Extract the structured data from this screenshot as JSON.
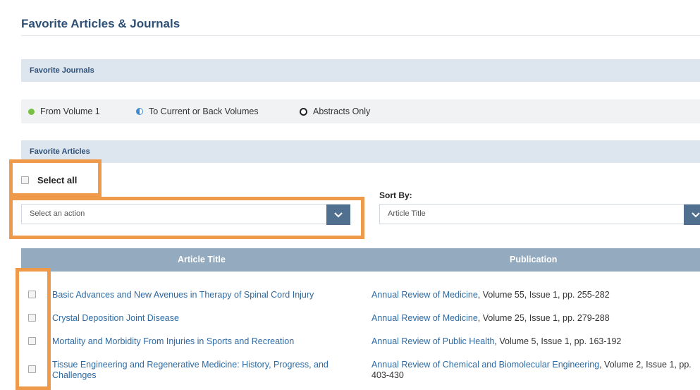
{
  "page": {
    "title": "Favorite Articles & Journals"
  },
  "favorite_journals": {
    "heading": "Favorite Journals"
  },
  "legend": {
    "items": [
      {
        "label": "From Volume 1",
        "icon": "green-dot-icon",
        "color": "#77c043"
      },
      {
        "label": "To Current or Back Volumes",
        "icon": "half-filled-dot-icon",
        "color": "#3a8ad3"
      },
      {
        "label": "Abstracts Only",
        "icon": "open-circle-icon",
        "color": "#222222"
      }
    ]
  },
  "favorite_articles": {
    "heading": "Favorite Articles",
    "select_all_label": "Select all",
    "action_placeholder": "Select an action",
    "sort_by_label": "Sort By:",
    "sort_value": "Article Title"
  },
  "table": {
    "headers": {
      "title": "Article Title",
      "publication": "Publication"
    },
    "rows": [
      {
        "title": "Basic Advances and New Avenues in Therapy of Spinal Cord Injury",
        "journal": "Annual Review of Medicine",
        "details": ", Volume 55, Issue 1, pp. 255-282"
      },
      {
        "title": "Crystal Deposition Joint Disease",
        "journal": "Annual Review of Medicine",
        "details": ", Volume 25, Issue 1, pp. 279-288"
      },
      {
        "title": "Mortality and Morbidity From Injuries in Sports and Recreation",
        "journal": "Annual Review of Public Health",
        "details": ", Volume 5, Issue 1, pp. 163-192"
      },
      {
        "title": "Tissue Engineering and Regenerative Medicine: History, Progress, and Challenges",
        "journal": "Annual Review of Chemical and Biomolecular Engineering",
        "details": ", Volume 2, Issue 1, pp. 403-430"
      }
    ]
  },
  "colors": {
    "heading": "#2d4f75",
    "band": "#dde5ef",
    "table_header": "#94aabe",
    "link": "#2d6aa3",
    "highlight": "#ef9a4a"
  }
}
